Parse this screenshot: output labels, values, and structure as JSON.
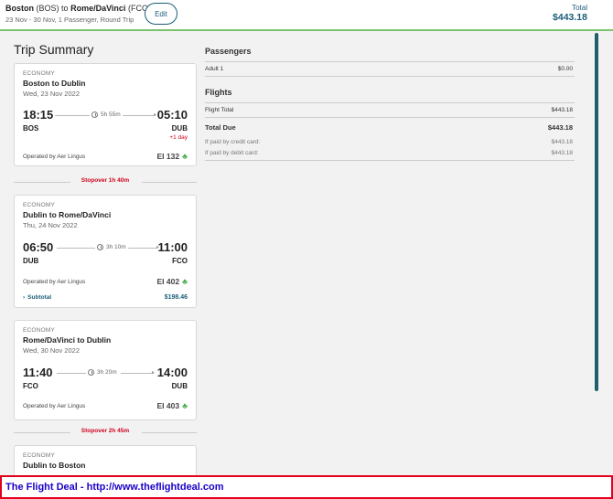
{
  "header": {
    "origin_city": "Boston",
    "origin_code": "(BOS)",
    "to_word": "to",
    "dest_city": "Rome/DaVinci",
    "dest_code": "(FCO)",
    "subinfo": "23 Nov - 30 Nov, 1 Passenger, Round Trip",
    "edit_label": "Edit",
    "total_label": "Total",
    "total_value": "$443.18"
  },
  "trip_summary": {
    "title": "Trip Summary",
    "flights": [
      {
        "cabin": "ECONOMY",
        "leg": "Boston to Dublin",
        "date": "Wed, 23 Nov 2022",
        "dep_time": "18:15",
        "arr_time": "05:10",
        "duration": "5h 55m",
        "dep_code": "BOS",
        "arr_code": "DUB",
        "plus_day": "+1 day",
        "operator": "Operated by Aer Lingus",
        "flight_no": "EI 132"
      },
      {
        "cabin": "ECONOMY",
        "leg": "Dublin to Rome/DaVinci",
        "date": "Thu, 24 Nov 2022",
        "dep_time": "06:50",
        "arr_time": "11:00",
        "duration": "3h 10m",
        "dep_code": "DUB",
        "arr_code": "FCO",
        "operator": "Operated by Aer Lingus",
        "flight_no": "EI 402",
        "subtotal_label": "Subtotal",
        "subtotal_value": "$198.46"
      },
      {
        "cabin": "ECONOMY",
        "leg": "Rome/DaVinci to Dublin",
        "date": "Wed, 30 Nov 2022",
        "dep_time": "11:40",
        "arr_time": "14:00",
        "duration": "3h 20m",
        "dep_code": "FCO",
        "arr_code": "DUB",
        "operator": "Operated by Aer Lingus",
        "flight_no": "EI 403"
      },
      {
        "cabin": "ECONOMY",
        "leg": "Dublin to Boston"
      }
    ],
    "stopovers": [
      "Stopover 1h 40m",
      "Stopover 2h 45m"
    ]
  },
  "price": {
    "passengers_title": "Passengers",
    "adult_label": "Adult 1",
    "adult_value": "$0.00",
    "flights_title": "Flights",
    "flight_total_label": "Flight Total",
    "flight_total_value": "$443.18",
    "total_due_label": "Total Due",
    "total_due_value": "$443.18",
    "credit_label": "If paid by credit card:",
    "credit_value": "$443.18",
    "debit_label": "If paid by debit card:",
    "debit_value": "$443.18"
  },
  "footer": {
    "text": "The Flight Deal - http://www.theflightdeal.com"
  },
  "colors": {
    "accent": "#1a5d7a",
    "header_rule": "#7cc36e",
    "stopover": "#d0021b",
    "footer_border": "#e3001b",
    "footer_text": "#1a00c8"
  }
}
